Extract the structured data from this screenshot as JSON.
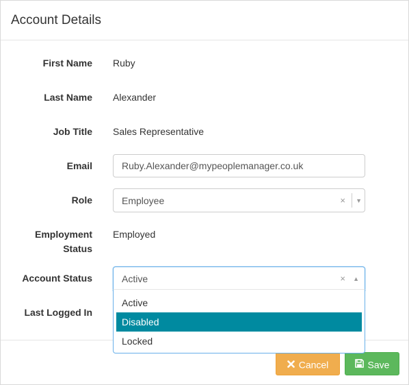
{
  "header": {
    "title": "Account Details"
  },
  "fields": {
    "first_name": {
      "label": "First Name",
      "value": "Ruby"
    },
    "last_name": {
      "label": "Last Name",
      "value": "Alexander"
    },
    "job_title": {
      "label": "Job Title",
      "value": "Sales Representative"
    },
    "email": {
      "label": "Email",
      "value": "Ruby.Alexander@mypeoplemanager.co.uk"
    },
    "role": {
      "label": "Role",
      "value": "Employee",
      "clear": "×",
      "arrow": "▼"
    },
    "employment_status": {
      "label_line1": "Employment",
      "label_line2": "Status",
      "value": "Employed"
    },
    "account_status": {
      "label": "Account Status",
      "value": "Active",
      "clear": "×",
      "arrow": "▲",
      "options": [
        "Active",
        "Disabled",
        "Locked"
      ],
      "highlighted": "Disabled"
    },
    "last_logged_in": {
      "label": "Last Logged In"
    }
  },
  "footer": {
    "cancel_label": "Cancel",
    "save_label": "Save"
  },
  "colors": {
    "cancel": "#f0ad4e",
    "save": "#5cb85c",
    "highlight": "#008aa0",
    "focus_border": "#66afe9"
  }
}
